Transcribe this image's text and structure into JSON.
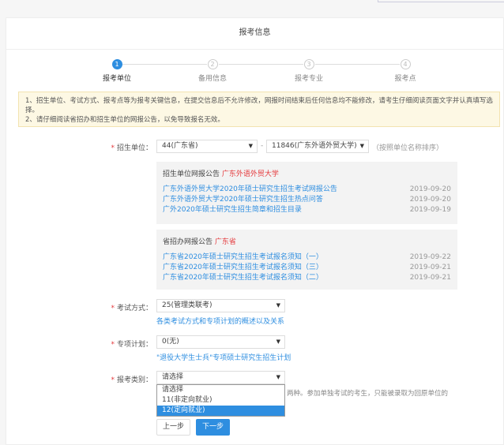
{
  "title": "报考信息",
  "steps": [
    {
      "num": "1",
      "label": "报考单位",
      "active": true
    },
    {
      "num": "2",
      "label": "备用信息"
    },
    {
      "num": "3",
      "label": "报考专业"
    },
    {
      "num": "4",
      "label": "报考点"
    }
  ],
  "notice": [
    "1、招生单位、考试方式、报考点等为报考关键信息，在提交信息后不允许修改，网报时间结束后任何信息均不能修改，请考生仔细阅读页面文字并认真填写选择。",
    "2、请仔细阅读省招办和招生单位的网报公告，以免导致报名无效。"
  ],
  "unit": {
    "label": "招生单位：",
    "province": "44(广东省)",
    "dash": "-",
    "school": "11846(广东外语外贸大学)",
    "hint": "（按照单位名称排序）"
  },
  "school_notices": {
    "heading": "招生单位网报公告",
    "name": "广东外语外贸大学",
    "items": [
      {
        "title": "广东外语外贸大学2020年硕士研究生招生考试网报公告",
        "date": "2019-09-20"
      },
      {
        "title": "广东外语外贸大学2020年硕士研究生招生热点问答",
        "date": "2019-09-20"
      },
      {
        "title": "广外2020年硕士研究生招生简章和招生目录",
        "date": "2019-09-19"
      }
    ]
  },
  "province_notices": {
    "heading": "省招办网报公告",
    "name": "广东省",
    "items": [
      {
        "title": "广东省2020年硕士研究生招生考试报名须知（一）",
        "date": "2019-09-22"
      },
      {
        "title": "广东省2020年硕士研究生招生考试报名须知（三）",
        "date": "2019-09-21"
      },
      {
        "title": "广东省2020年硕士研究生招生考试报名须知（二）",
        "date": "2019-09-21"
      }
    ]
  },
  "exam_mode": {
    "label": "考试方式：",
    "value": "25(管理类联考)",
    "link": "各类考试方式和专项计划的概述以及关系"
  },
  "special_plan": {
    "label": "专项计划：",
    "value": "0(无)",
    "link": "\"退役大学生士兵\"专项硕士研究生招生计划"
  },
  "category": {
    "label": "报考类别：",
    "value": "请选择",
    "options": [
      "请选择",
      "11(非定向就业)",
      "12(定向就业)"
    ],
    "highlighted": "12(定向就业)",
    "hidden_hint": "两种。参加单独考试的考生，只能被录取为回原单位的"
  },
  "buttons": {
    "prev": "上一步",
    "next": "下一步"
  },
  "colors": {
    "accent": "#2e8ee0",
    "required": "#e4393c",
    "notice_bg": "#fdf8e4"
  }
}
